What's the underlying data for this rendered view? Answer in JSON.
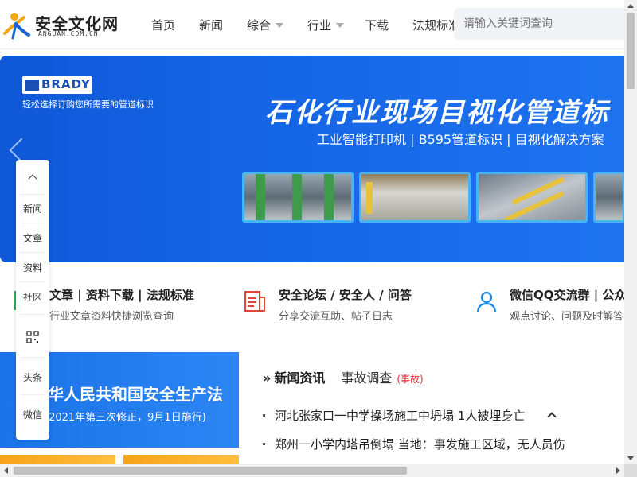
{
  "header": {
    "logo_text": "安全文化网",
    "logo_sub": "ANGUAN.COM.CN",
    "nav": [
      {
        "label": "首页",
        "caret": false
      },
      {
        "label": "新闻",
        "caret": false
      },
      {
        "label": "综合",
        "caret": true
      },
      {
        "label": "行业",
        "caret": true
      },
      {
        "label": "下载",
        "caret": false
      },
      {
        "label": "法规标准",
        "caret": false
      }
    ],
    "search_placeholder": "请输入关键词查询"
  },
  "banner": {
    "brand": "BRADY",
    "subtitle": "轻松选择订购您所需要的管道标识",
    "title": "石化行业现场目视化管道标",
    "line": "工业智能打印机 | B595管道标识 | 目视化解决方案"
  },
  "features": [
    {
      "title": "文章 | 资料下载 | 法规标准",
      "desc": "行业文章资料快捷浏览查询",
      "icon": "document-icon"
    },
    {
      "title": "安全论坛 / 安全人 / 问答",
      "desc": "分享交流互助、帖子日志",
      "icon": "forum-icon"
    },
    {
      "title": "微信QQ交流群 | 公众",
      "desc": "观点讨论、问题及时解答",
      "icon": "user-icon"
    }
  ],
  "promo": {
    "title": "华人民共和国安全生产法",
    "subtitle": "(2021年第三次修正，9月1日施行)"
  },
  "news": {
    "head_label": "新闻资讯",
    "tab": "事故调查",
    "tag": "(事故)",
    "items": [
      "河北张家口一中学操场施工中坍塌 1人被埋身亡",
      "郑州一小学内塔吊倒塌 当地：事发施工区域，无人员伤",
      "..."
    ]
  },
  "side_menu": [
    "新闻",
    "文章",
    "资料",
    "社区",
    "头条",
    "微信"
  ],
  "colors": {
    "banner_blue": "#1566e6",
    "accent_red": "#e02b2b",
    "promo_orange": "#f7a21b"
  }
}
